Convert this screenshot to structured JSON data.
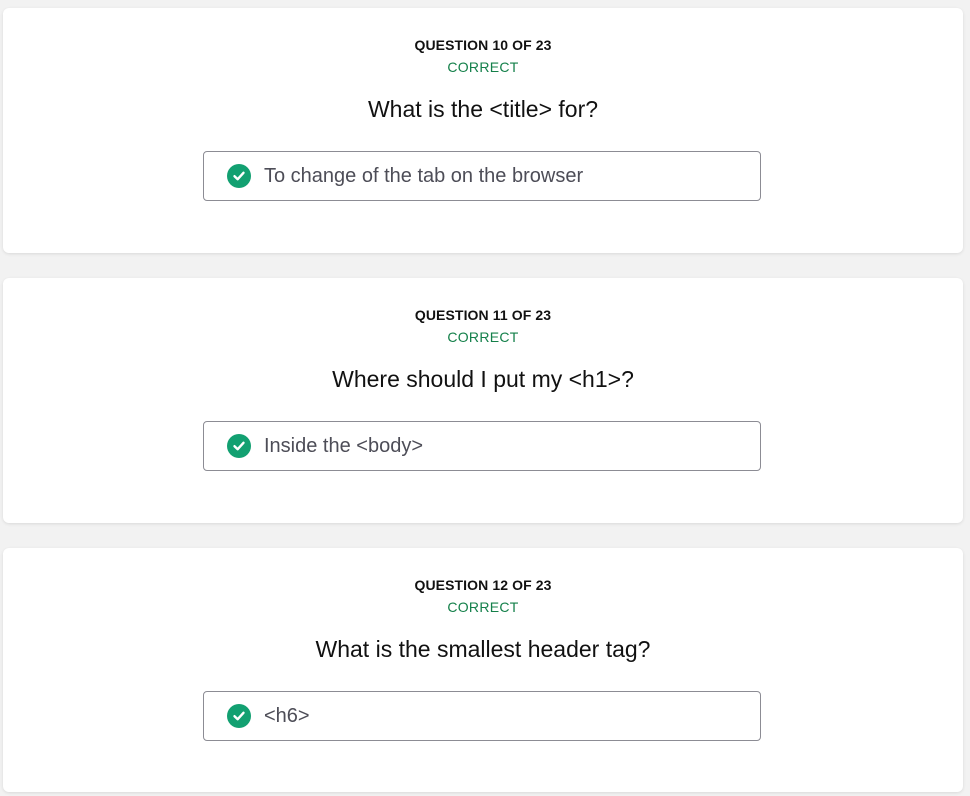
{
  "accent": {
    "correct_color": "#14804a",
    "check_color": "#12a071"
  },
  "questions": [
    {
      "number_label": "QUESTION 10 OF 23",
      "status": "CORRECT",
      "question": "What is the <title> for?",
      "answer": "To change of the tab on the browser",
      "answer_icon": "check-circle-icon"
    },
    {
      "number_label": "QUESTION 11 OF 23",
      "status": "CORRECT",
      "question": "Where should I put my <h1>?",
      "answer": "Inside the <body>",
      "answer_icon": "check-circle-icon"
    },
    {
      "number_label": "QUESTION 12 OF 23",
      "status": "CORRECT",
      "question": "What is the smallest header tag?",
      "answer": "<h6>",
      "answer_icon": "check-circle-icon"
    }
  ]
}
